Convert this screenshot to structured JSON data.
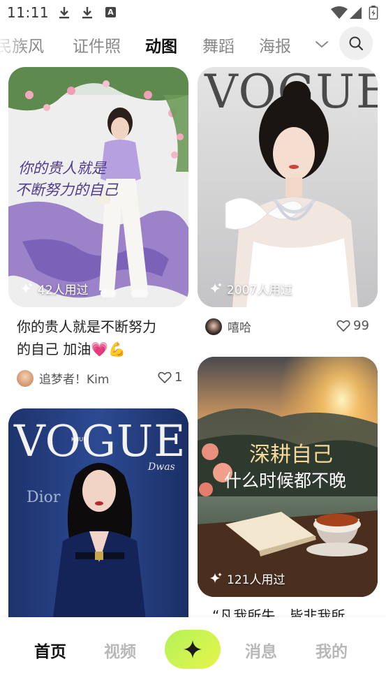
{
  "status_bar": {
    "time": "11:11",
    "notification_icons": [
      "download-icon",
      "download-icon",
      "font-a-icon"
    ],
    "a_label": "A",
    "system_icons": [
      "wifi-icon",
      "signal-icon",
      "battery-icon"
    ]
  },
  "category_tabs": {
    "items": [
      {
        "label": "民族风",
        "active": false
      },
      {
        "label": "证件照",
        "active": false
      },
      {
        "label": "动图",
        "active": true
      },
      {
        "label": "舞蹈",
        "active": false
      },
      {
        "label": "海报",
        "active": false
      }
    ],
    "expand_icon": "chevron-down-icon",
    "search_icon": "search-icon",
    "highlight_color": "#b5f04a"
  },
  "feed": {
    "cards": [
      {
        "image_text_line1": "你的贵人就是",
        "image_text_line2": "不断努力的自己",
        "usage": "42人用过",
        "title_line1": "你的贵人就是不断努力",
        "title_line2": "的自己 加油💗💪",
        "author": "追梦者！Kim",
        "likes": "1"
      },
      {
        "image_text": "VOGUE",
        "usage": "2007人用过",
        "author": "嘻哈",
        "likes": "99"
      },
      {
        "image_text": "VOGUE",
        "image_sub_1": "KHUF",
        "image_sub_2": "Dior",
        "image_sub_3": "Dwas",
        "usage": ""
      },
      {
        "image_text_line1": "深耕自己",
        "image_text_line2": "什么时候都不晚",
        "usage": "121人用过",
        "title_partial": "“凡我所失，皆非我所"
      }
    ]
  },
  "bottom_nav": {
    "items": [
      {
        "label": "首页",
        "active": true
      },
      {
        "label": "视频",
        "active": false
      },
      {
        "label": "消息",
        "active": false
      },
      {
        "label": "我的",
        "active": false
      }
    ],
    "create_icon": "sparkle-icon",
    "create_color": "#b4f25a"
  }
}
